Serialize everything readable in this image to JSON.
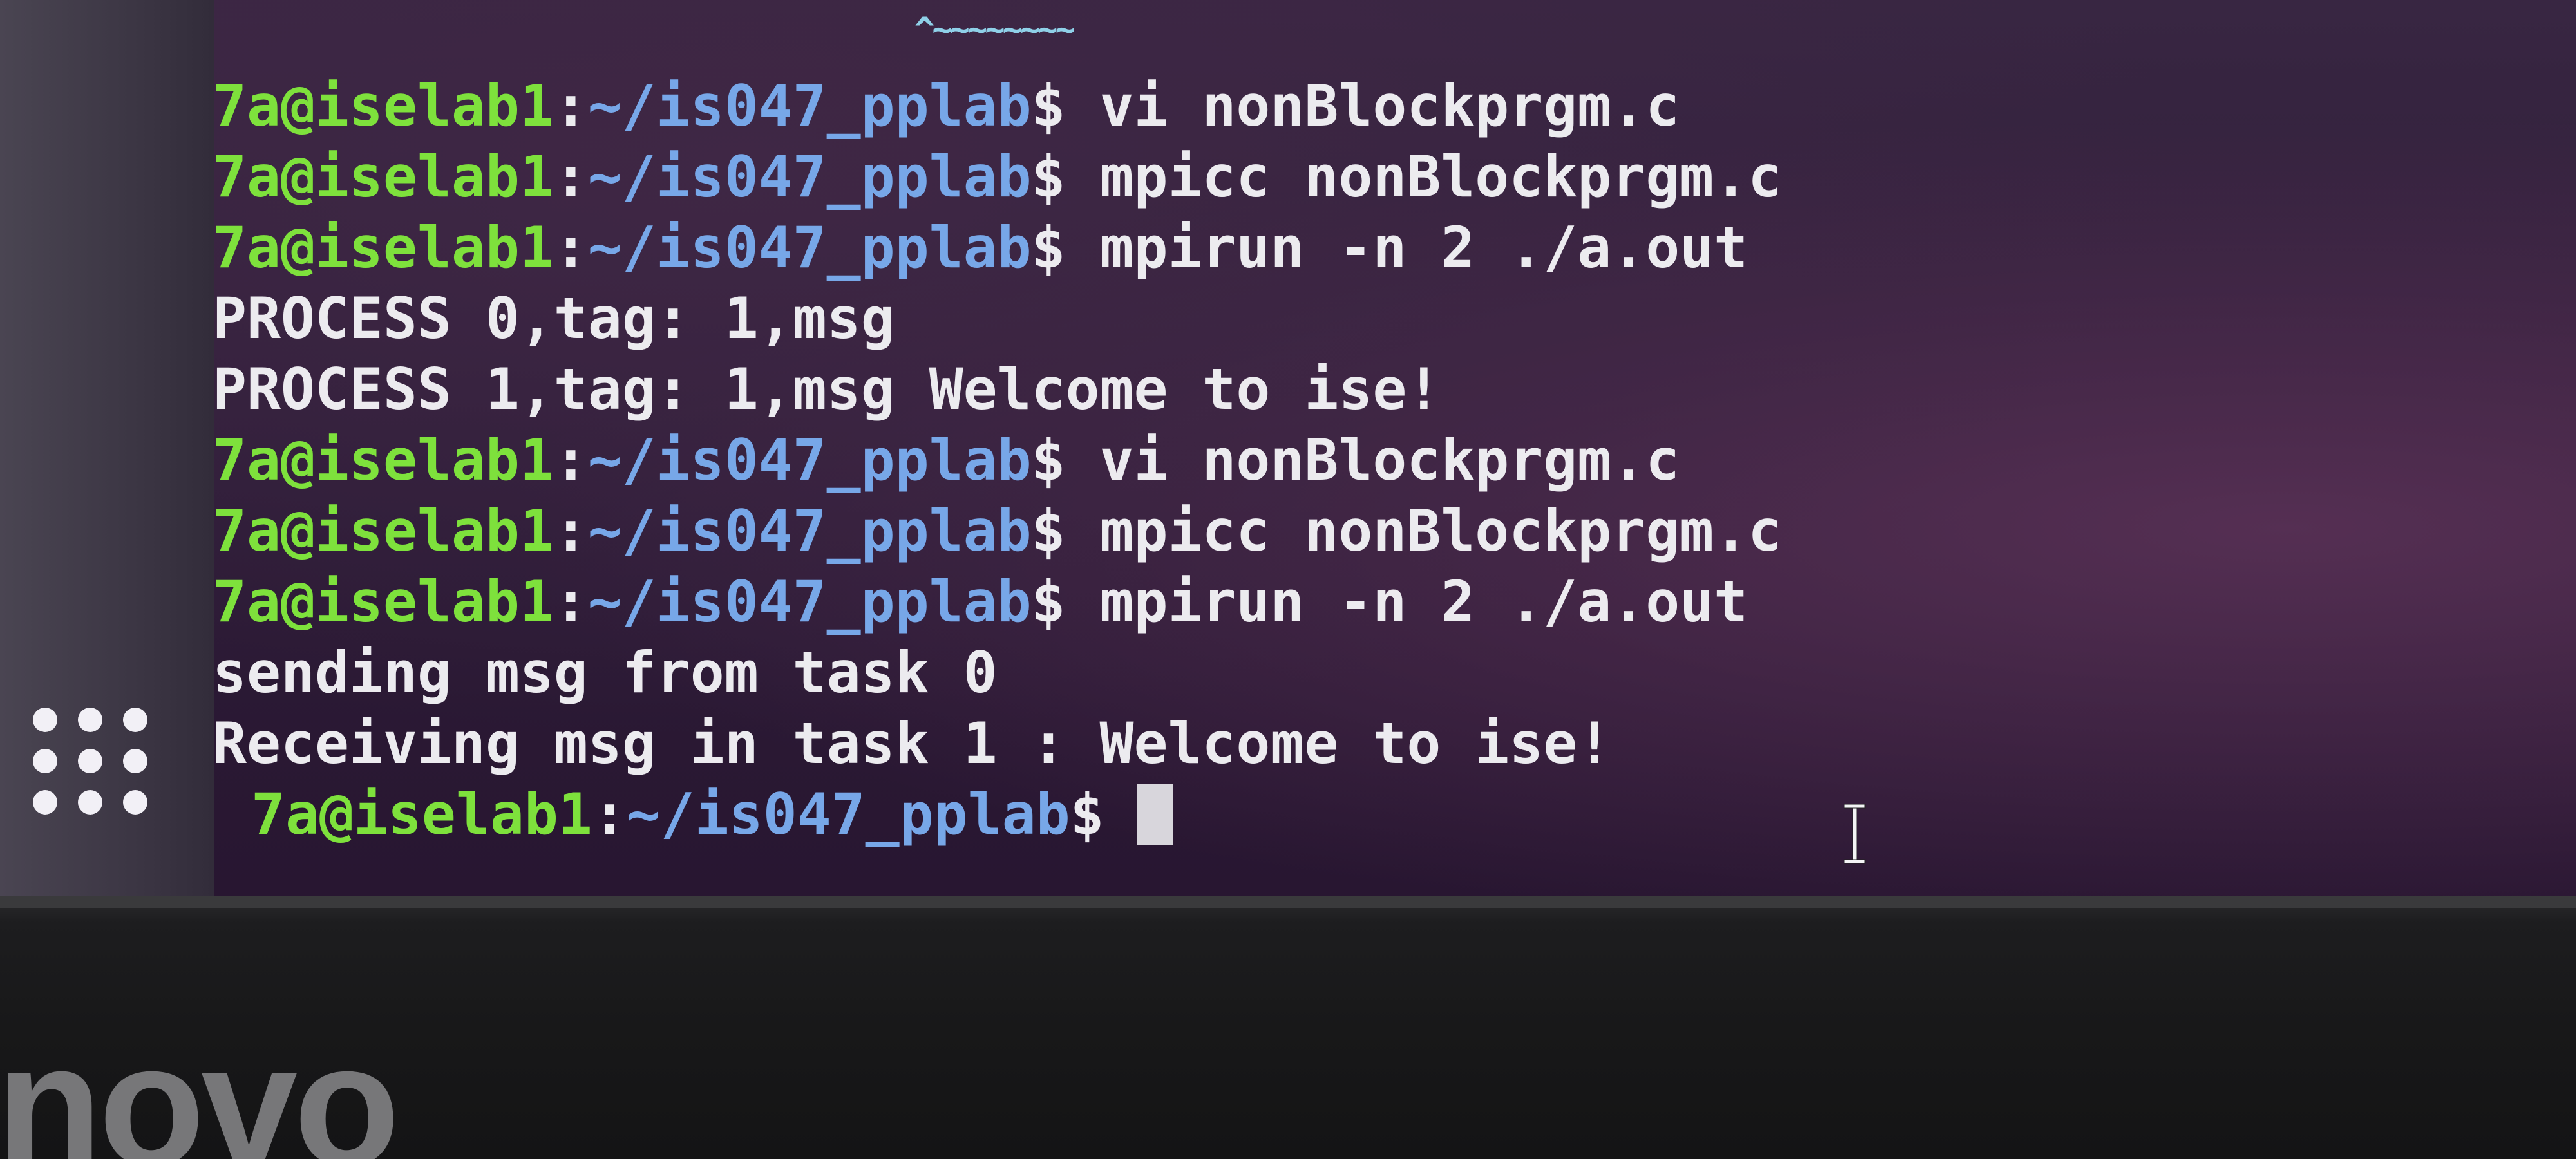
{
  "partial_title": "^~~~~~~~~",
  "terminal": {
    "prompt_user": "7a@iselab1",
    "prompt_separator": ":",
    "prompt_path": "~/is047_pplab",
    "prompt_symbol": "$",
    "lines": [
      {
        "type": "command",
        "command": " vi nonBlockprgm.c"
      },
      {
        "type": "command",
        "command": " mpicc nonBlockprgm.c"
      },
      {
        "type": "command",
        "command": " mpirun -n 2 ./a.out"
      },
      {
        "type": "output",
        "text": "PROCESS 0,tag: 1,msg"
      },
      {
        "type": "output",
        "text": "PROCESS 1,tag: 1,msg Welcome to ise!"
      },
      {
        "type": "command",
        "command": " vi nonBlockprgm.c"
      },
      {
        "type": "command",
        "command": " mpicc nonBlockprgm.c"
      },
      {
        "type": "command",
        "command": " mpirun -n 2 ./a.out"
      },
      {
        "type": "output",
        "text": "sending msg from task 0"
      },
      {
        "type": "output",
        "text": "Receiving msg in task 1 : Welcome to ise!"
      }
    ]
  },
  "dock": {
    "show_apps_icon": "apps-grid-icon"
  },
  "mouse_pointer_icon": "ibeam-cursor-icon",
  "laptop_brand": "enovo",
  "colors": {
    "prompt_user": "#7ee13c",
    "prompt_path": "#77a7e8",
    "text": "#ecebef",
    "terminal_background": "#2c1b36"
  }
}
